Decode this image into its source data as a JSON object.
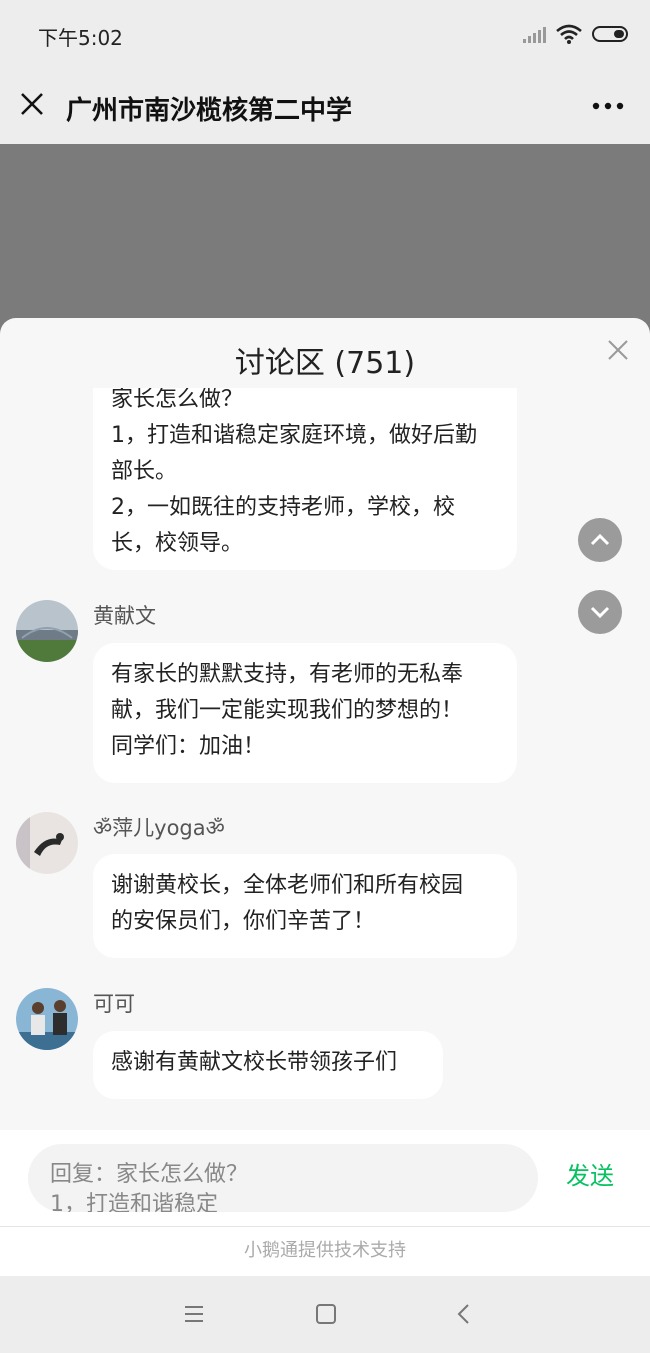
{
  "status_bar": {
    "time": "下午5:02",
    "icons": [
      "signal-icon",
      "wifi-icon",
      "battery-icon"
    ]
  },
  "header": {
    "title": "广州市南沙榄核第二中学",
    "close_icon": "close-icon",
    "more_icon": "more-icon"
  },
  "panel": {
    "title": "讨论区 (751)"
  },
  "messages": [
    {
      "lines": [
        "家长怎么做？",
        "1，打造和谐稳定家庭环境，做好后勤",
        "部长。",
        "2，一如既往的支持老师，学校，校",
        "长，校领导。"
      ]
    },
    {
      "user": "黄献文",
      "lines": [
        "有家长的默默支持，有老师的无私奉",
        "献，我们一定能实现我们的梦想的！",
        "同学们：加油！"
      ]
    },
    {
      "user": "ॐ萍儿yogaॐ",
      "lines": [
        "谢谢黄校长，全体老师们和所有校园",
        "的安保员们，你们辛苦了！"
      ]
    },
    {
      "user": "可可",
      "lines": [
        "感谢有黄献文校长带领孩子们"
      ]
    }
  ],
  "reply": {
    "text_line1": "回复：家长怎么做？",
    "text_line2": "1，打造和谐稳定",
    "send_label": "发送"
  },
  "footer": {
    "support_text": "小鹅通提供技术支持"
  },
  "colors": {
    "accent": "#07c160",
    "background": "#ededed",
    "bubble": "#ffffff",
    "video": "#7b7b7b"
  }
}
